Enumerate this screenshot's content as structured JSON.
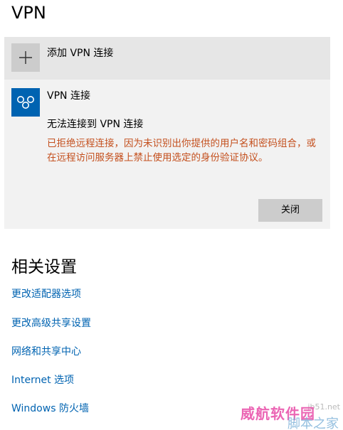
{
  "page": {
    "title": "VPN"
  },
  "add_vpn": {
    "label": "添加 VPN 连接"
  },
  "vpn_connection": {
    "name": "VPN 连接",
    "status": "无法连接到 VPN 连接",
    "error": "已拒绝远程连接，因为未识别出你提供的用户名和密码组合，或在远程访问服务器上禁止使用选定的身份验证协议。",
    "close_label": "关闭",
    "icon": "vpn-connection-icon",
    "tile_color": "#0063b1",
    "error_color": "#c4501e"
  },
  "related_settings": {
    "title": "相关设置",
    "links": [
      "更改适配器选项",
      "更改高级共享设置",
      "网络和共享中心",
      "Internet 选项",
      "Windows 防火墙"
    ],
    "link_color": "#0063b1"
  },
  "watermark": {
    "site": "jb51.net",
    "brand": "威航软件园",
    "sub": "脚本之家"
  }
}
